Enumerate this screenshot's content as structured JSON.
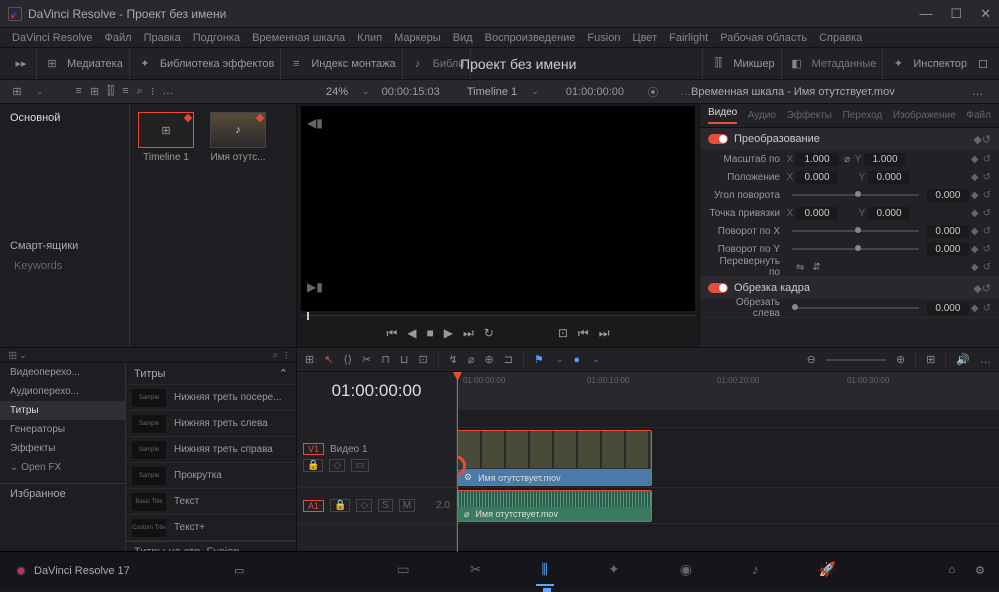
{
  "window": {
    "title": "DaVinci Resolve - Проект без имени"
  },
  "menubar": [
    "DaVinci Resolve",
    "Файл",
    "Правка",
    "Подгонка",
    "Временная шкала",
    "Клип",
    "Маркеры",
    "Вид",
    "Воспроизведение",
    "Fusion",
    "Цвет",
    "Fairlight",
    "Рабочая область",
    "Справка"
  ],
  "toolbar": {
    "media": "Медиатека",
    "fx": "Библиотека эффектов",
    "editindex": "Индекс монтажа",
    "soundlib": "Библи",
    "mixer": "Микшер",
    "metadata": "Метаданные",
    "inspector": "Инспектор"
  },
  "project_name": "Проект без имени",
  "subheader": {
    "zoom_pct": "24%",
    "duration_tc": "00:00:15:03",
    "timeline_name": "Timeline 1",
    "position_tc": "01:00:00:00",
    "inspector_title": "Временная шкала - Имя отутствует.mov"
  },
  "media_pool": {
    "master": "Основной",
    "thumbs": [
      {
        "label": "Timeline 1",
        "icon_char": "⊞",
        "selected": true
      },
      {
        "label": "Имя отутс...",
        "icon_char": "♪",
        "selected": false
      }
    ],
    "smart_bins": "Смарт-ящики",
    "keywords": "Keywords"
  },
  "inspector": {
    "tabs": [
      "Видео",
      "Аудио",
      "Эффекты",
      "Переход",
      "Изображение",
      "Файл"
    ],
    "section1": {
      "title": "Преобразование"
    },
    "rows": {
      "scale": {
        "label": "Масштаб по",
        "x": "1.000",
        "y": "1.000"
      },
      "position": {
        "label": "Положение",
        "x": "0.000",
        "y": "0.000"
      },
      "angle": {
        "label": "Угол поворота",
        "val": "0.000"
      },
      "anchor": {
        "label": "Точка привязки",
        "x": "0.000",
        "y": "0.000"
      },
      "rotX": {
        "label": "Поворот по X",
        "val": "0.000"
      },
      "rotY": {
        "label": "Поворот по Y",
        "val": "0.000"
      },
      "flip": {
        "label": "Перевернуть по"
      }
    },
    "section2": {
      "title": "Обрезка кадра"
    },
    "crop_left": {
      "label": "Обрезать слева",
      "val": "0.000"
    }
  },
  "fx": {
    "categories": [
      "Видеоперехо...",
      "Аудиоперехо...",
      "Титры",
      "Генераторы",
      "Эффекты"
    ],
    "openfx": "Open FX",
    "favorites": "Избранное",
    "list_title": "Титры",
    "items": [
      {
        "thumb": "Sample",
        "label": "Нижняя треть посере..."
      },
      {
        "thumb": "Sample",
        "label": "Нижняя треть слева"
      },
      {
        "thumb": "Sample",
        "label": "Нижняя треть справа"
      },
      {
        "thumb": "Sample",
        "label": "Прокрутка"
      },
      {
        "thumb": "Basic Title",
        "label": "Текст"
      },
      {
        "thumb": "Custom Title",
        "label": "Текст+"
      }
    ],
    "footer": "Титры на стр. Fusion"
  },
  "timeline": {
    "current_tc": "01:00:00:00",
    "ruler_ticks": [
      "01:00:00:00",
      "01:00:10:00",
      "01:00:20:00",
      "01:00:30:00"
    ],
    "tracks": {
      "v1": {
        "badge": "V1",
        "name": "Видео 1"
      },
      "a1": {
        "badge": "A1",
        "amix": "2.0"
      }
    },
    "clip_video": "Имя отутствует.mov",
    "clip_audio": "Имя отутствует.mov"
  },
  "footer": {
    "brand": "DaVinci Resolve 17"
  }
}
